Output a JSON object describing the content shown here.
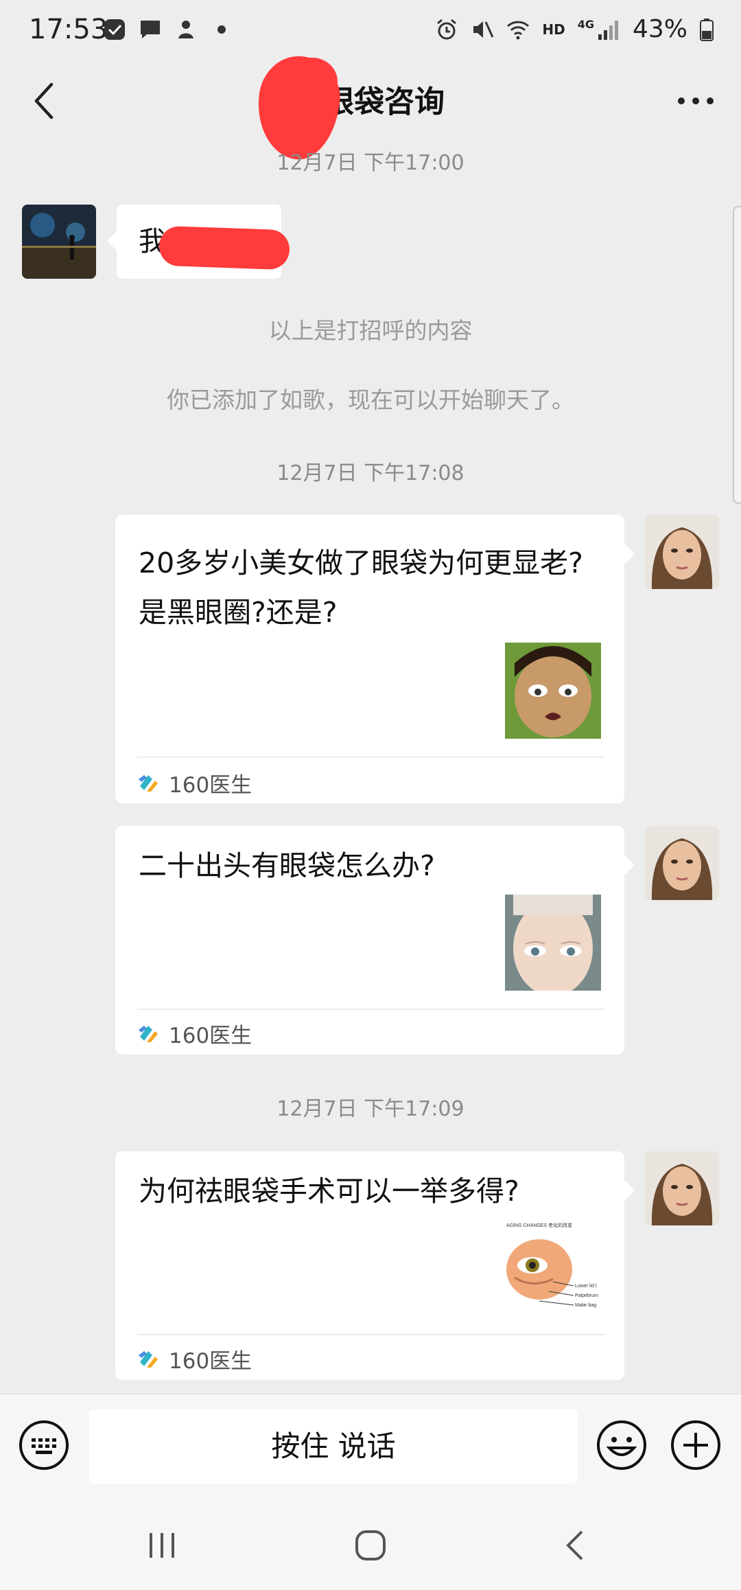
{
  "status_bar": {
    "time": "17:53",
    "network": "HD",
    "signal_label": "4G",
    "battery": "43%"
  },
  "header": {
    "title": "眼袋咨询",
    "back_icon": "chevron-left-icon",
    "more_icon": "more-dots-icon"
  },
  "chat": {
    "timestamps": [
      "12月7日 下午17:00",
      "12月7日 下午17:08",
      "12月7日 下午17:09"
    ],
    "incoming_message": "我",
    "system_messages": [
      "以上是打招呼的内容",
      "你已添加了如歌，现在可以开始聊天了。"
    ],
    "cards": [
      {
        "title": "20多岁小美女做了眼袋为何更显老?是黑眼圈?还是?",
        "source": "160医生"
      },
      {
        "title": "二十出头有眼袋怎么办?",
        "source": "160医生"
      },
      {
        "title": "为何祛眼袋手术可以一举多得?",
        "source": "160医生"
      }
    ],
    "thumb3_caption": "AGING CHANGES  老化的改变",
    "thumb3_labels": [
      "Lower lid l",
      "Palpebrum",
      "Malar bag"
    ]
  },
  "input_bar": {
    "hold_to_talk": "按住 说话",
    "keyboard_icon": "keyboard-icon",
    "emoji_icon": "emoji-icon",
    "plus_icon": "plus-icon"
  },
  "nav_bar": {
    "recent_icon": "recent-apps-icon",
    "home_icon": "home-icon",
    "back_icon": "back-icon"
  }
}
